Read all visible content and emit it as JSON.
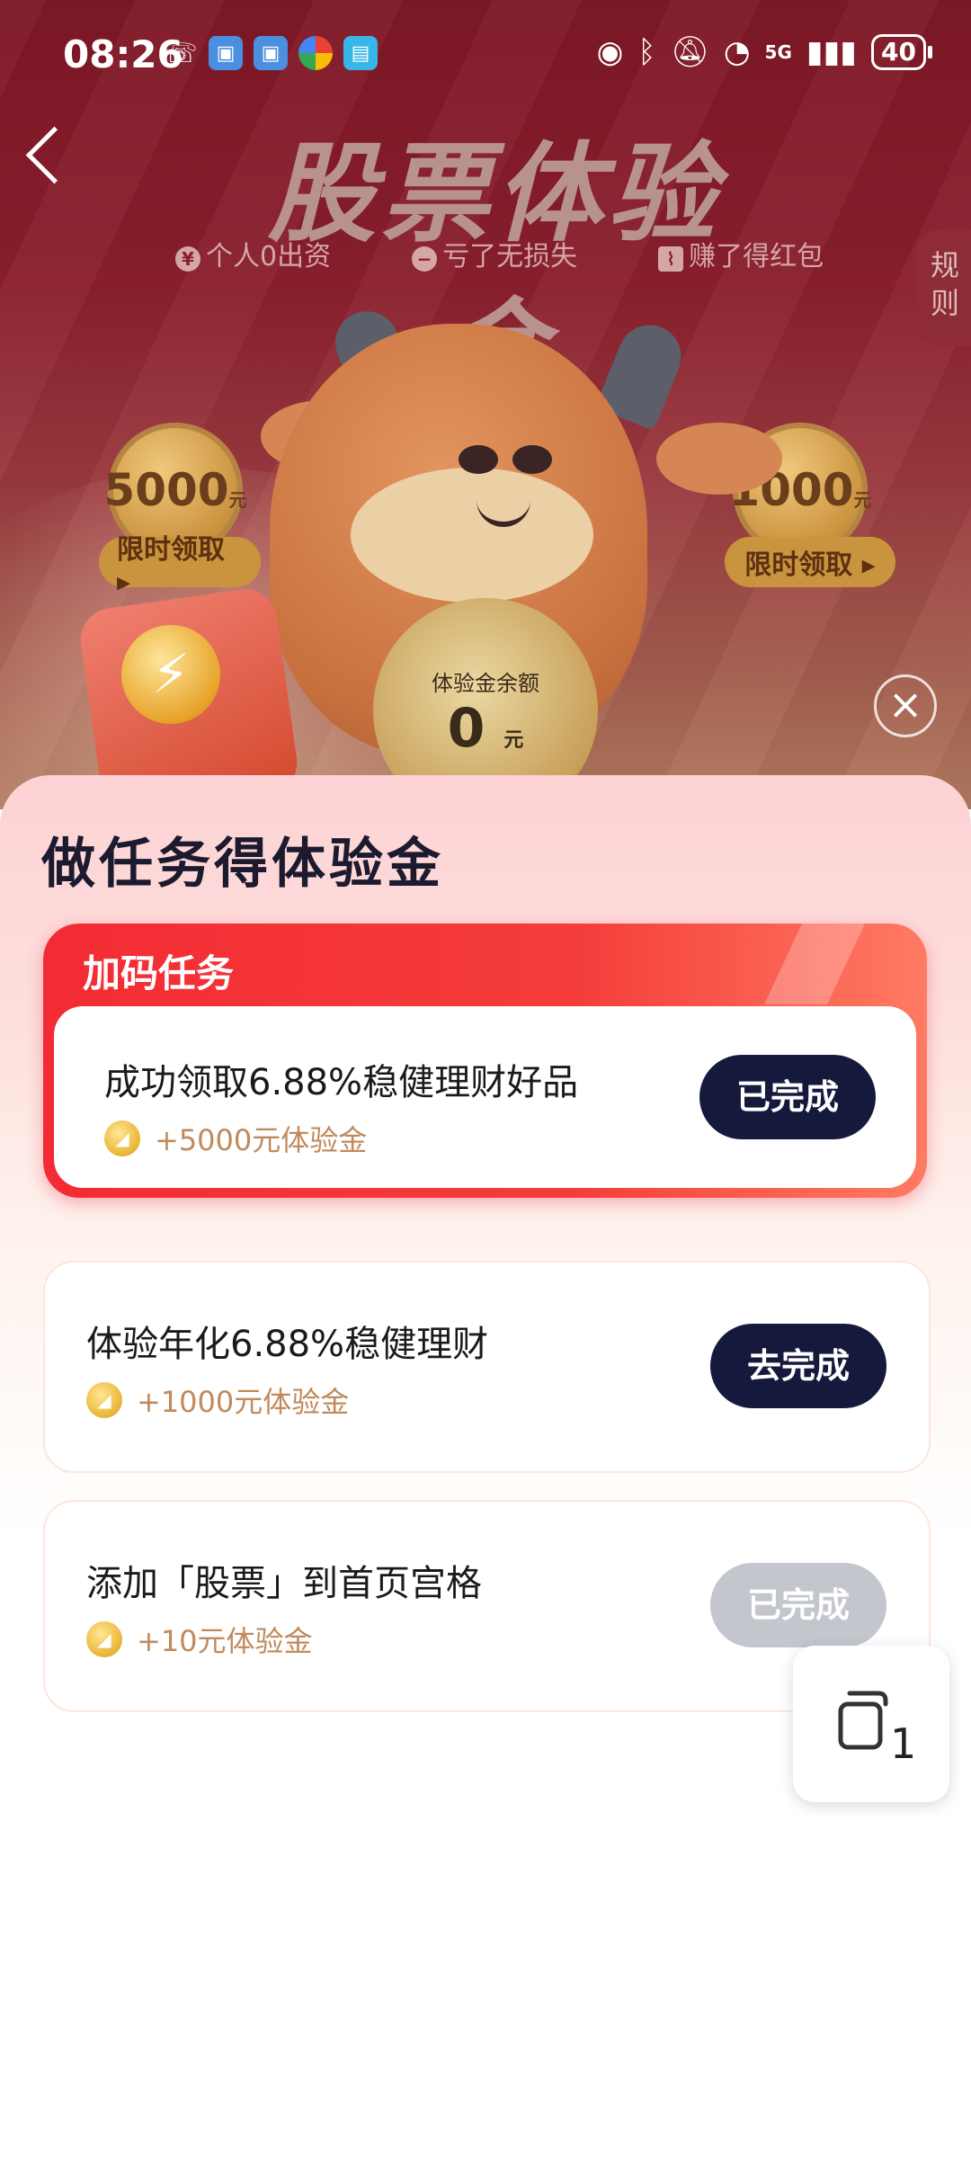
{
  "status_bar": {
    "time": "08:26",
    "network": "5G",
    "battery": "40"
  },
  "header": {
    "title": "股票体验金",
    "rules_label": "规则",
    "tags": [
      "个人0出资",
      "亏了无损失",
      "赚了得红包"
    ]
  },
  "banner": {
    "left_coin": {
      "amount": "5000",
      "unit": "元",
      "button": "限时领取 ▸"
    },
    "right_coin": {
      "amount": "1000",
      "unit": "元",
      "button": "限时领取 ▸"
    },
    "balance": {
      "label": "体验金余额",
      "value": "0",
      "unit": "元"
    }
  },
  "sheet": {
    "title": "做任务得体验金",
    "bonus_section": {
      "label": "加码任务",
      "task": {
        "title": "成功领取6.88%稳健理财好品",
        "reward": "+5000元体验金",
        "button": "已完成"
      }
    },
    "tasks": [
      {
        "title": "体验年化6.88%稳健理财",
        "reward": "+1000元体验金",
        "button": "去完成",
        "state": "active"
      },
      {
        "title": "添加「股票」到首页宫格",
        "reward": "+10元体验金",
        "button": "已完成",
        "state": "done"
      }
    ]
  },
  "floating_widget": {
    "badge": "1"
  },
  "colors": {
    "banner_bg": "#8a1f2d",
    "bonus_red": "#f32b34",
    "button_dark": "#151a3d",
    "button_disabled": "#c4c6ce",
    "reward_text": "#c08a5c"
  }
}
